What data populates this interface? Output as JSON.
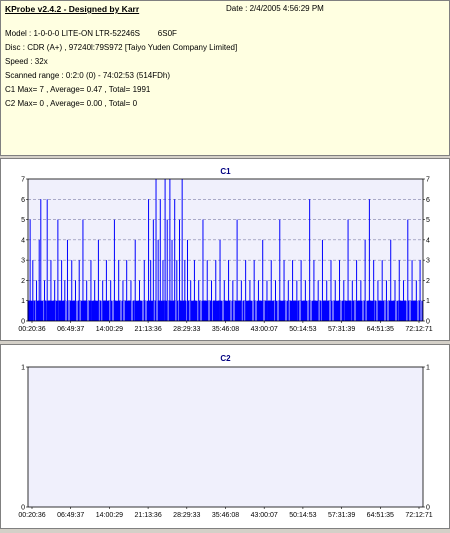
{
  "header": {
    "title": "KProbe v2.4.2 - Designed by Karr",
    "date": "Date : 2/4/2005 4:56:29 PM"
  },
  "info": {
    "model": "Model : 1-0-0-0 LITE-ON LTR-52246S        6S0F",
    "disc": "Disc : CDR (A+) , 97240l:79S972 [Taiyo Yuden Company Limited]",
    "speed": "Speed : 32x",
    "scanned_range": "Scanned range : 0:2:0 (0) - 74:02:53 (514FDh)",
    "c1": "C1 Max= 7 , Average= 0.47 , Total= 1991",
    "c2": "C2 Max= 0 , Average= 0.00 , Total= 0"
  },
  "colors": {
    "plot_bg": "#f0f0fc",
    "bar": "#0000ff",
    "grid": "#7f7fa8",
    "title": "#000080"
  },
  "chart_data": [
    {
      "type": "bar",
      "title": "C1",
      "ylim": [
        0,
        7
      ],
      "yticks": [
        0,
        1,
        2,
        3,
        4,
        5,
        6,
        7
      ],
      "xticks": [
        "00:20:36",
        "06:49:37",
        "14:00:29",
        "21:13:36",
        "28:29:33",
        "35:46:08",
        "43:00:07",
        "50:14:53",
        "57:31:39",
        "64:51:35",
        "72:12:71"
      ],
      "xlim_minutes": [
        0,
        74.05
      ],
      "grid": true,
      "baseline_value": 1,
      "max": 7,
      "average": 0.47,
      "spikes": [
        {
          "t": 0.4,
          "v": 5
        },
        {
          "t": 0.9,
          "v": 3
        },
        {
          "t": 1.6,
          "v": 2
        },
        {
          "t": 2.1,
          "v": 4
        },
        {
          "t": 2.4,
          "v": 6
        },
        {
          "t": 3.1,
          "v": 2
        },
        {
          "t": 3.6,
          "v": 6
        },
        {
          "t": 4.3,
          "v": 3
        },
        {
          "t": 5.0,
          "v": 2
        },
        {
          "t": 5.6,
          "v": 5
        },
        {
          "t": 6.3,
          "v": 3
        },
        {
          "t": 6.9,
          "v": 2
        },
        {
          "t": 7.4,
          "v": 4
        },
        {
          "t": 8.2,
          "v": 3
        },
        {
          "t": 8.9,
          "v": 2
        },
        {
          "t": 9.6,
          "v": 3
        },
        {
          "t": 10.3,
          "v": 5
        },
        {
          "t": 11.0,
          "v": 2
        },
        {
          "t": 11.8,
          "v": 3
        },
        {
          "t": 12.5,
          "v": 2
        },
        {
          "t": 13.2,
          "v": 4
        },
        {
          "t": 14.0,
          "v": 2
        },
        {
          "t": 14.7,
          "v": 3
        },
        {
          "t": 15.5,
          "v": 2
        },
        {
          "t": 16.2,
          "v": 5
        },
        {
          "t": 17.0,
          "v": 3
        },
        {
          "t": 17.8,
          "v": 2
        },
        {
          "t": 18.5,
          "v": 3
        },
        {
          "t": 19.3,
          "v": 2
        },
        {
          "t": 20.1,
          "v": 4
        },
        {
          "t": 20.9,
          "v": 2
        },
        {
          "t": 21.8,
          "v": 3
        },
        {
          "t": 22.6,
          "v": 6
        },
        {
          "t": 23.0,
          "v": 3
        },
        {
          "t": 23.5,
          "v": 5
        },
        {
          "t": 24.0,
          "v": 7
        },
        {
          "t": 24.4,
          "v": 4
        },
        {
          "t": 24.8,
          "v": 6
        },
        {
          "t": 25.3,
          "v": 3
        },
        {
          "t": 25.7,
          "v": 7
        },
        {
          "t": 26.1,
          "v": 5
        },
        {
          "t": 26.6,
          "v": 7
        },
        {
          "t": 27.0,
          "v": 4
        },
        {
          "t": 27.5,
          "v": 6
        },
        {
          "t": 27.9,
          "v": 3
        },
        {
          "t": 28.4,
          "v": 5
        },
        {
          "t": 28.9,
          "v": 7
        },
        {
          "t": 29.4,
          "v": 3
        },
        {
          "t": 29.9,
          "v": 4
        },
        {
          "t": 30.5,
          "v": 2
        },
        {
          "t": 31.2,
          "v": 3
        },
        {
          "t": 32.0,
          "v": 2
        },
        {
          "t": 32.8,
          "v": 5
        },
        {
          "t": 33.6,
          "v": 3
        },
        {
          "t": 34.4,
          "v": 2
        },
        {
          "t": 35.2,
          "v": 3
        },
        {
          "t": 36.0,
          "v": 4
        },
        {
          "t": 36.8,
          "v": 2
        },
        {
          "t": 37.6,
          "v": 3
        },
        {
          "t": 38.4,
          "v": 2
        },
        {
          "t": 39.2,
          "v": 5
        },
        {
          "t": 40.0,
          "v": 2
        },
        {
          "t": 40.8,
          "v": 3
        },
        {
          "t": 41.6,
          "v": 2
        },
        {
          "t": 42.4,
          "v": 3
        },
        {
          "t": 43.2,
          "v": 2
        },
        {
          "t": 44.0,
          "v": 4
        },
        {
          "t": 44.8,
          "v": 2
        },
        {
          "t": 45.6,
          "v": 3
        },
        {
          "t": 46.4,
          "v": 2
        },
        {
          "t": 47.2,
          "v": 5
        },
        {
          "t": 48.0,
          "v": 3
        },
        {
          "t": 48.8,
          "v": 2
        },
        {
          "t": 49.6,
          "v": 3
        },
        {
          "t": 50.4,
          "v": 2
        },
        {
          "t": 51.2,
          "v": 3
        },
        {
          "t": 52.0,
          "v": 2
        },
        {
          "t": 52.8,
          "v": 6
        },
        {
          "t": 53.6,
          "v": 3
        },
        {
          "t": 54.4,
          "v": 2
        },
        {
          "t": 55.2,
          "v": 4
        },
        {
          "t": 56.0,
          "v": 2
        },
        {
          "t": 56.8,
          "v": 3
        },
        {
          "t": 57.6,
          "v": 2
        },
        {
          "t": 58.4,
          "v": 3
        },
        {
          "t": 59.2,
          "v": 2
        },
        {
          "t": 60.0,
          "v": 5
        },
        {
          "t": 60.8,
          "v": 2
        },
        {
          "t": 61.6,
          "v": 3
        },
        {
          "t": 62.4,
          "v": 2
        },
        {
          "t": 63.2,
          "v": 4
        },
        {
          "t": 64.0,
          "v": 6
        },
        {
          "t": 64.8,
          "v": 3
        },
        {
          "t": 65.6,
          "v": 2
        },
        {
          "t": 66.4,
          "v": 3
        },
        {
          "t": 67.2,
          "v": 2
        },
        {
          "t": 68.0,
          "v": 4
        },
        {
          "t": 68.8,
          "v": 2
        },
        {
          "t": 69.6,
          "v": 3
        },
        {
          "t": 70.4,
          "v": 2
        },
        {
          "t": 71.2,
          "v": 5
        },
        {
          "t": 72.0,
          "v": 3
        },
        {
          "t": 72.8,
          "v": 2
        },
        {
          "t": 73.5,
          "v": 3
        }
      ]
    },
    {
      "type": "bar",
      "title": "C2",
      "ylim": [
        0,
        1
      ],
      "yticks": [
        0,
        1
      ],
      "xticks": [
        "00:20:36",
        "06:49:37",
        "14:00:29",
        "21:13:36",
        "28:29:33",
        "35:46:08",
        "43:00:07",
        "50:14:53",
        "57:31:39",
        "64:51:35",
        "72:12:71"
      ],
      "xlim_minutes": [
        0,
        74.05
      ],
      "grid": false,
      "max": 0,
      "average": 0.0,
      "spikes": []
    }
  ]
}
